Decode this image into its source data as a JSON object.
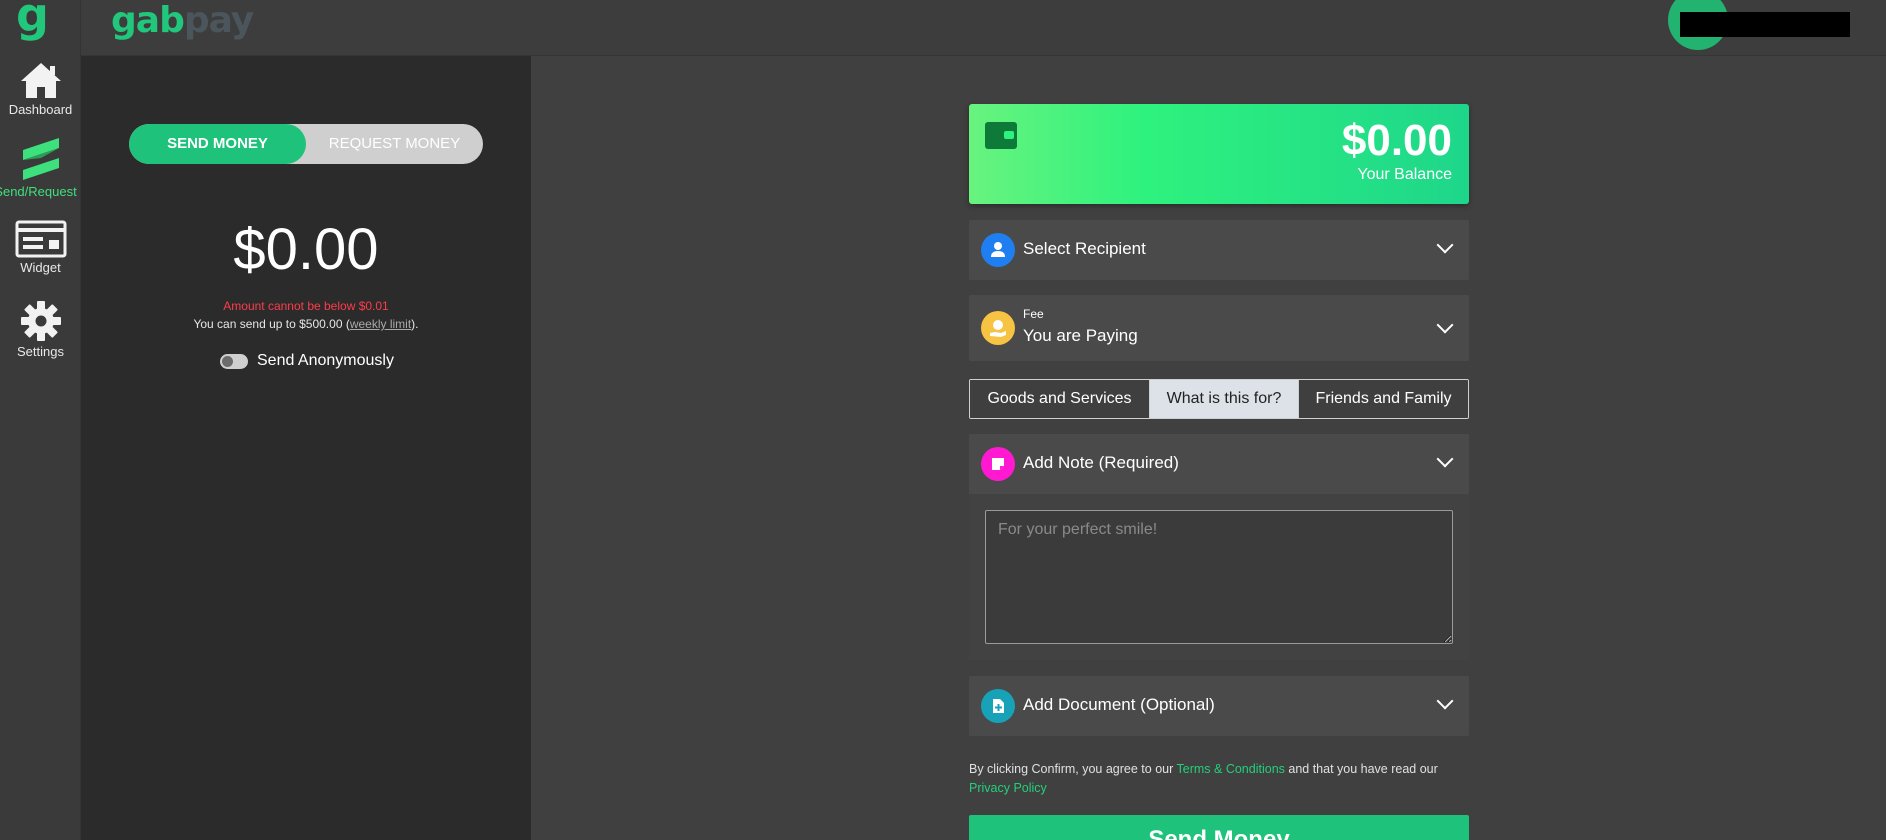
{
  "rail": {
    "logo": "g",
    "items": [
      {
        "label": "Dashboard",
        "icon": "home-icon"
      },
      {
        "label": "Send/Request",
        "icon": "send-request-icon"
      },
      {
        "label": "Widget",
        "icon": "widget-icon"
      },
      {
        "label": "Settings",
        "icon": "gear-icon"
      }
    ]
  },
  "brand": {
    "part1": "gab",
    "part2": "pay"
  },
  "send_panel": {
    "tab_send": "SEND MONEY",
    "tab_request": "REQUEST MONEY",
    "amount": "$0.00",
    "error": "Amount cannot be below $0.01",
    "limit_prefix": "You can send up to $500.00 (",
    "limit_link": "weekly limit",
    "limit_suffix": ").",
    "anonymous_label": "Send Anonymously"
  },
  "balance": {
    "amount": "$0.00",
    "label": "Your Balance"
  },
  "recipient": {
    "label": "Select Recipient"
  },
  "fee": {
    "small": "Fee",
    "label": "You are Paying"
  },
  "purpose": {
    "options": [
      "Goods and Services",
      "What is this for?",
      "Friends and Family"
    ],
    "selected": "What is this for?"
  },
  "note": {
    "label": "Add Note (Required)",
    "placeholder": "For your perfect smile!"
  },
  "document": {
    "label": "Add Document (Optional)"
  },
  "legal": {
    "text1": "By clicking Confirm, you agree to our ",
    "terms": "Terms & Conditions",
    "text2": " and that you have read our ",
    "privacy": "Privacy Policy"
  },
  "submit": {
    "label": "Send Money"
  },
  "colors": {
    "accent": "#1ec27a",
    "error": "#ff3b4a"
  }
}
